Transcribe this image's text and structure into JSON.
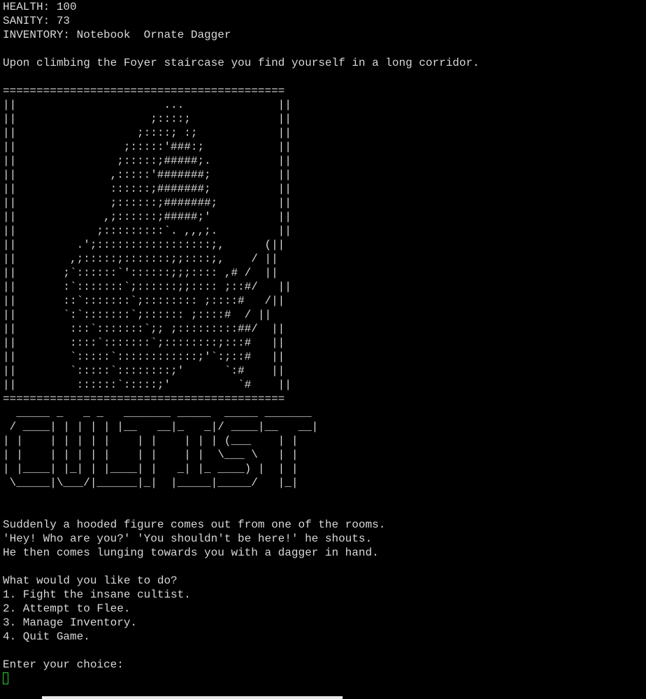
{
  "status": {
    "health_label": "HEALTH:",
    "health_value": "100",
    "sanity_label": "SANITY:",
    "sanity_value": "73",
    "inventory_label": "INVENTORY:",
    "inventory_items": [
      "Notebook",
      "Ornate Dagger"
    ]
  },
  "narration_intro": "Upon climbing the Foyer staircase you find yourself in a long corridor.",
  "art_frame": "==========================================\n||                      ...              ||\n||                    ;::::;             ||\n||                  ;::::; :;            ||\n||                ;:::::'###:;           ||\n||               ;:::::;#####;.          ||\n||              ,:::::'#######;          ||\n||              ::::::;#######;          ||\n||              ;::::::;#######;         ||\n||             ,;::::::;#####;'          ||\n||            ;:::::::::`. ,,,;.         ||\n||         .';:::::::::::::::::;,      (||\n||        ,;:::::;:::::::;;::::;,    / ||\n||       ;`::::::`'::::::;;;:::: ,# /  ||\n||       :`:::::::`;::::::;;:::: ;::#/   ||\n||       ::`:::::::`;:::::::: ;::::#   /||\n||       `:`:::::::`;:::::: ;::::#  / ||\n||        :::`:::::::`;; ;:::::::::##/  ||\n||        ::::`:::::::`;::::::::;:::#   ||\n||        `:::::`::::::::::::;'`:;::#   ||\n||        `:::::`::::::::;'      `:#    ||\n||         ::::::`:::::;'          `#    ||\n==========================================",
  "art_title": "  _____ _   _ _   _______ _____  _____ _______\n / ____| | | | | |__   __|_   _|/ ____|__   __|\n| |    | | | | |    | |    | | | (___    | |\n| |    | | | | |    | |    | |  \\___ \\   | |\n| |____| |_| | |____| |   _| |_ ____) |  | |\n \\_____|\\___/|______|_|  |_____|_____/   |_|",
  "narration_encounter": [
    "Suddenly a hooded figure comes out from one of the rooms.",
    "'Hey! Who are you?' 'You shouldn't be here!' he shouts.",
    "He then comes lunging towards you with a dagger in hand."
  ],
  "menu": {
    "prompt": "What would you like to do?",
    "options": [
      "1. Fight the insane cultist.",
      "2. Attempt to Flee.",
      "3. Manage Inventory.",
      "4. Quit Game."
    ]
  },
  "input_prompt": "Enter your choice:"
}
